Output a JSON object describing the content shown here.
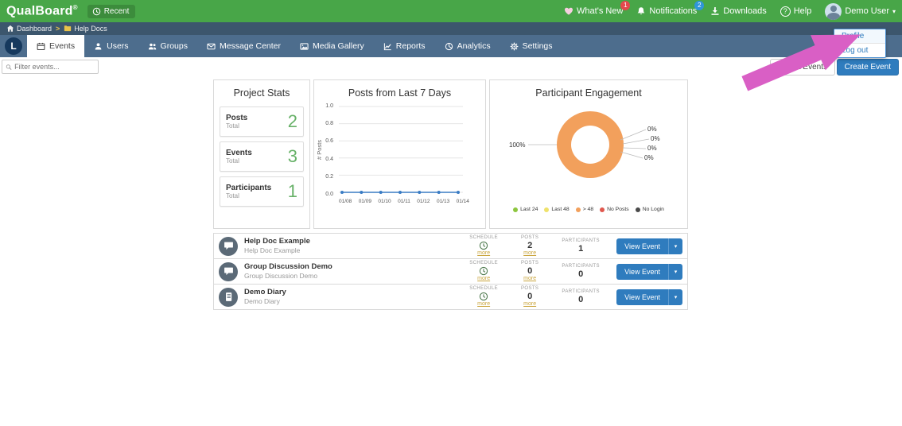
{
  "topbar": {
    "brand": "QualBoard",
    "brand_sup": "®",
    "recent": "Recent",
    "whats_new": "What's New",
    "whats_new_badge": "1",
    "notifications": "Notifications",
    "notifications_badge": "2",
    "downloads": "Downloads",
    "help": "Help",
    "user": "Demo User"
  },
  "icons": {
    "help_glyph": "?",
    "caret_down": "▾",
    "breadcrumb_sep": ">"
  },
  "breadcrumb": {
    "home": "Dashboard",
    "folder": "Help Docs"
  },
  "user_menu": {
    "profile": "Profile",
    "logout": "Log out"
  },
  "project": {
    "avatar_letter": "L"
  },
  "nav": {
    "tabs": [
      {
        "label": "Events",
        "active": true
      },
      {
        "label": "Users"
      },
      {
        "label": "Groups"
      },
      {
        "label": "Message Center"
      },
      {
        "label": "Media Gallery"
      },
      {
        "label": "Reports"
      },
      {
        "label": "Analytics"
      },
      {
        "label": "Settings"
      }
    ]
  },
  "toolbar": {
    "filter_placeholder": "Filter events...",
    "export": "Export Events",
    "create": "Create Event"
  },
  "stats": {
    "title": "Project Stats",
    "items": [
      {
        "label": "Posts",
        "sub": "Total",
        "value": "2"
      },
      {
        "label": "Events",
        "sub": "Total",
        "value": "3"
      },
      {
        "label": "Participants",
        "sub": "Total",
        "value": "1"
      }
    ]
  },
  "chart_data": [
    {
      "type": "line",
      "title": "Posts from Last 7 Days",
      "xlabel": "",
      "ylabel": "# Posts",
      "x": [
        "01/08",
        "01/09",
        "01/10",
        "01/11",
        "01/12",
        "01/13",
        "01/14"
      ],
      "values": [
        0,
        0,
        0,
        0,
        0,
        0,
        0
      ],
      "ylim": [
        0,
        1.0
      ],
      "yticks": [
        "1.0",
        "0.8",
        "0.6",
        "0.4",
        "0.2",
        "0.0"
      ],
      "grid": true,
      "line_color": "#3a7cc4"
    },
    {
      "type": "pie",
      "title": "Participant Engagement",
      "labels": [
        "Last 24",
        "Last 48",
        "> 48",
        "No Posts",
        "No Login"
      ],
      "values": [
        0,
        0,
        100,
        0,
        0
      ],
      "colors": [
        "#8dc63f",
        "#efe26b",
        "#f2a05c",
        "#e0584e",
        "#4a4a4a"
      ],
      "callouts": {
        "left": "100%",
        "right": [
          "0%",
          "0%",
          "0%",
          "0%"
        ]
      },
      "legend_position": "bottom"
    }
  ],
  "events": {
    "columns": {
      "schedule": "SCHEDULE",
      "posts": "POSTS",
      "participants": "PARTICIPANTS"
    },
    "more": "more",
    "view": "View Event",
    "rows": [
      {
        "title": "Help Doc Example",
        "subtitle": "Help Doc Example",
        "icon": "chat-bubble",
        "posts": "2",
        "participants": "1"
      },
      {
        "title": "Group Discussion Demo",
        "subtitle": "Group Discussion Demo",
        "icon": "chat-bubble",
        "posts": "0",
        "participants": "0"
      },
      {
        "title": "Demo Diary",
        "subtitle": "Demo Diary",
        "icon": "diary",
        "posts": "0",
        "participants": "0"
      }
    ]
  },
  "colors": {
    "topbar_green": "#48a648",
    "breadcrumb_bar": "#3c566d",
    "nav_bar": "#4d6d8d",
    "accent_blue": "#2f7cbe",
    "stat_green": "#67b168",
    "badge_red": "#e5484d",
    "badge_blue": "#2f96d8",
    "more_link": "#caa53d",
    "annotation_pink": "#d95fc5"
  }
}
